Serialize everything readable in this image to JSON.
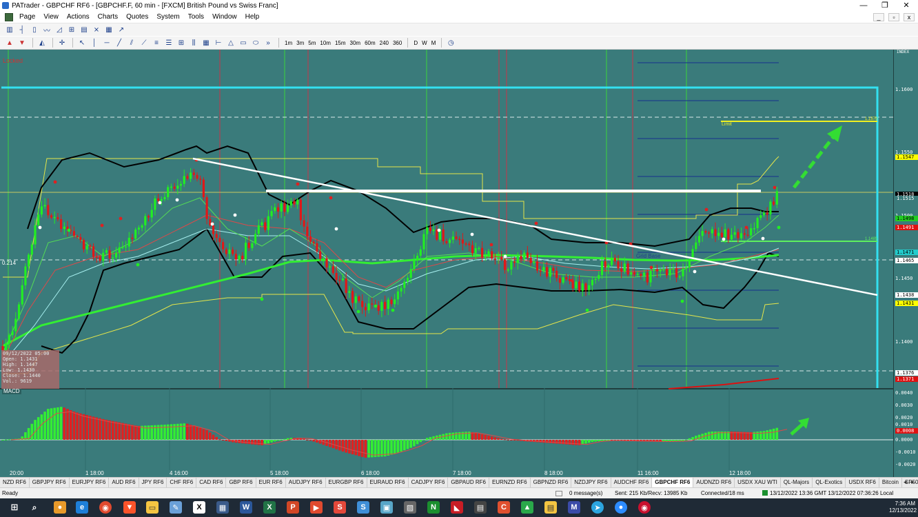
{
  "window": {
    "title": "PATrader - GBPCHF RF6 - [GBPCHF.F, 60 min - [FXCM] British Pound vs Swiss Franc]",
    "minimize": "—",
    "restore": "❐",
    "close": "✕"
  },
  "menu": {
    "items": [
      "Page",
      "View",
      "Actions",
      "Charts",
      "Quotes",
      "System",
      "Tools",
      "Window",
      "Help"
    ],
    "mdi_min": "_",
    "mdi_restore": "▫",
    "mdi_close": "x"
  },
  "toolbar2": {
    "timeframes": [
      "1m",
      "3m",
      "5m",
      "10m",
      "15m",
      "30m",
      "60m",
      "240",
      "360",
      "D",
      "W",
      "M"
    ]
  },
  "chart": {
    "locked_label": "Locked",
    "index_label": "INDEX",
    "grid_base_label": "Grid Base",
    "limit_label": "Limit",
    "left_value_label": "0.214",
    "limit_price_label": "1.1570",
    "mid_line_label": "1.1485",
    "ohlc": {
      "date": "09/12/2022 05:00",
      "open": "Open: 1.1431",
      "high": "High: 1.1447",
      "low": "Low: 1.1430",
      "close": "Close: 1.1440",
      "vol": "Vol.: 9619"
    },
    "price_axis": [
      "1.1600",
      "1.1550",
      "1.1500",
      "1.1450",
      "1.1400"
    ],
    "price_tags": [
      {
        "value": "1.1547",
        "bg": "#ffff00",
        "fg": "#000000"
      },
      {
        "value": "1.1518",
        "bg": "#000000",
        "fg": "#ffffff"
      },
      {
        "value": "1.1515",
        "bg": "#3a7b7b",
        "fg": "#ffffff"
      },
      {
        "value": "1.1498",
        "bg": "#22cc22",
        "fg": "#000000"
      },
      {
        "value": "1.1491",
        "bg": "#dd1111",
        "fg": "#ffffff"
      },
      {
        "value": "1.1471",
        "bg": "#22cccc",
        "fg": "#000000"
      },
      {
        "value": "1.1465",
        "bg": "#ffffff",
        "fg": "#000000"
      },
      {
        "value": "1.1438",
        "bg": "#ffffff",
        "fg": "#000000"
      },
      {
        "value": "1.1431",
        "bg": "#ffff00",
        "fg": "#000000"
      },
      {
        "value": "1.1376",
        "bg": "#ffffff",
        "fg": "#000000"
      },
      {
        "value": "1.1371",
        "bg": "#dd1111",
        "fg": "#ffffff"
      }
    ],
    "macd_label": "MACD",
    "macd_axis": [
      "0.0040",
      "0.0030",
      "0.0020",
      "0.0010",
      "0.0008",
      "0.0000",
      "-0.0010",
      "-0.0020"
    ],
    "time_labels": [
      "20:00",
      "1 18:00",
      "4 16:00",
      "5 18:00",
      "6 18:00",
      "7 18:00",
      "8 18:00",
      "11 16:00",
      "12 18:00"
    ],
    "colors": {
      "background": "#3a7b7b",
      "bull": "#22ee22",
      "bear": "#e01818",
      "trendline": "#ffffff",
      "box": "#33e0f0",
      "envelope": "#e6e64a",
      "bollinger": "#000000"
    }
  },
  "tabs": [
    "NZD RF6",
    "GBPJPY RF6",
    "EURJPY RF6",
    "AUD RF6",
    "JPY RF6",
    "CHF RF6",
    "CAD RF6",
    "GBP RF6",
    "EUR RF6",
    "AUDJPY RF6",
    "EURGBP RF6",
    "EURAUD RF6",
    "CADJPY RF6",
    "GBPAUD RF6",
    "EURNZD RF6",
    "GBPNZD RF6",
    "NZDJPY RF6",
    "AUDCHF RF6",
    "GBPCHF RF6",
    "AUDNZD RF6",
    "USDX XAU WTI",
    "QL-Majors",
    "QL-Exotics",
    "USDX RF6",
    "Bitcoin",
    "SP500"
  ],
  "active_tab": "GBPCHF RF6",
  "status": {
    "ready": "Ready",
    "messages": "0 message(s)",
    "traffic": "Sent: 215 Kb/Recv: 13985 Kb",
    "connected": "Connected/18 ms",
    "time": "13/12/2022 13:36 GMT  13/12/2022 07:36:26 Local"
  },
  "taskbar": {
    "clock_time": "7:36 AM",
    "clock_date": "12/13/2022"
  }
}
